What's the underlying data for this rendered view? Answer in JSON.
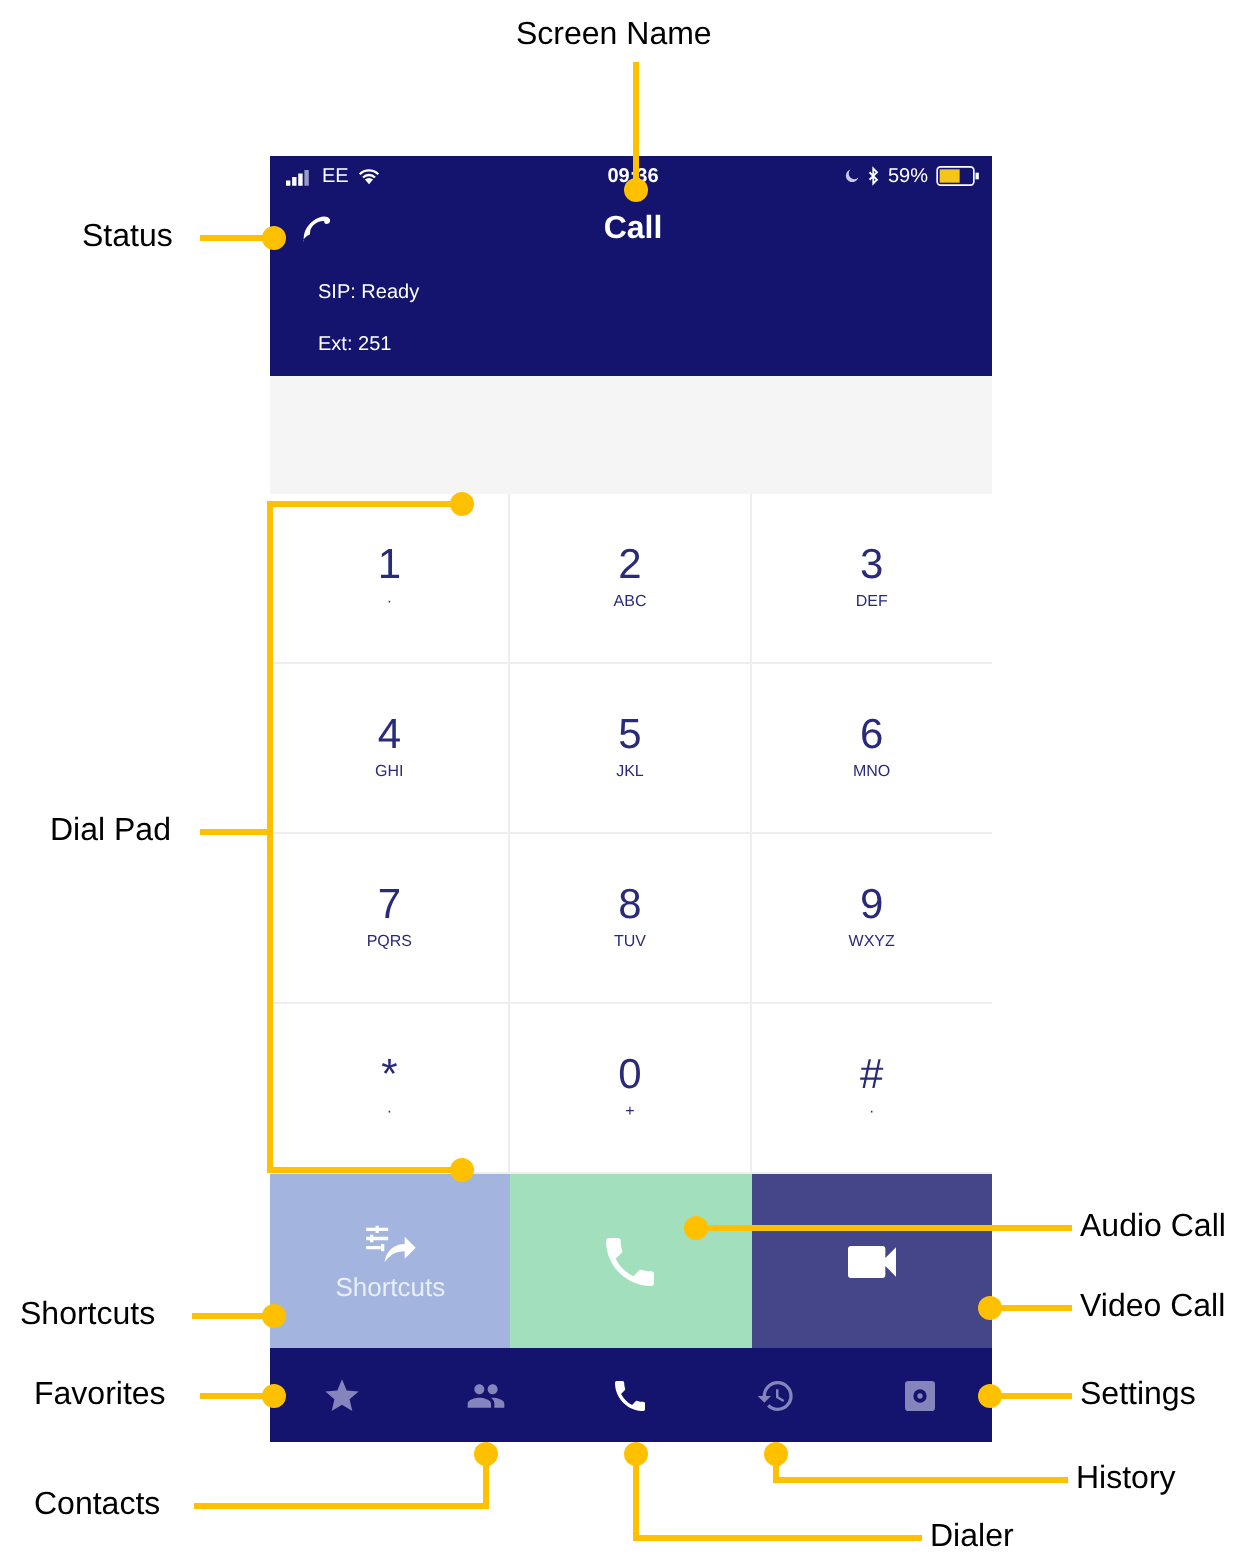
{
  "status_bar": {
    "carrier": "EE",
    "time": "09:36",
    "battery": "59%"
  },
  "header": {
    "title": "Call",
    "sip_status": "SIP: Ready",
    "extension": "Ext: 251"
  },
  "keypad": [
    {
      "digit": "1",
      "letters": "·"
    },
    {
      "digit": "2",
      "letters": "ABC"
    },
    {
      "digit": "3",
      "letters": "DEF"
    },
    {
      "digit": "4",
      "letters": "GHI"
    },
    {
      "digit": "5",
      "letters": "JKL"
    },
    {
      "digit": "6",
      "letters": "MNO"
    },
    {
      "digit": "7",
      "letters": "PQRS"
    },
    {
      "digit": "8",
      "letters": "TUV"
    },
    {
      "digit": "9",
      "letters": "WXYZ"
    },
    {
      "digit": "*",
      "letters": "·"
    },
    {
      "digit": "0",
      "letters": "+"
    },
    {
      "digit": "#",
      "letters": "·"
    }
  ],
  "actions": [
    {
      "kind": "shortcuts",
      "label": "Shortcuts"
    },
    {
      "kind": "audio"
    },
    {
      "kind": "video"
    }
  ],
  "nav": [
    {
      "kind": "favorites",
      "selected": false
    },
    {
      "kind": "contacts",
      "selected": false
    },
    {
      "kind": "dialer",
      "selected": true
    },
    {
      "kind": "history",
      "selected": false
    },
    {
      "kind": "settings",
      "selected": false
    }
  ],
  "callouts": [
    {
      "label": "Screen Name"
    },
    {
      "label": "Status"
    },
    {
      "label": "Dial Pad"
    },
    {
      "label": "Audio Call"
    },
    {
      "label": "Shortcuts"
    },
    {
      "label": "Video Call"
    },
    {
      "label": "Favorites"
    },
    {
      "label": "Settings"
    },
    {
      "label": "History"
    },
    {
      "label": "Contacts"
    },
    {
      "label": "Dialer"
    }
  ]
}
